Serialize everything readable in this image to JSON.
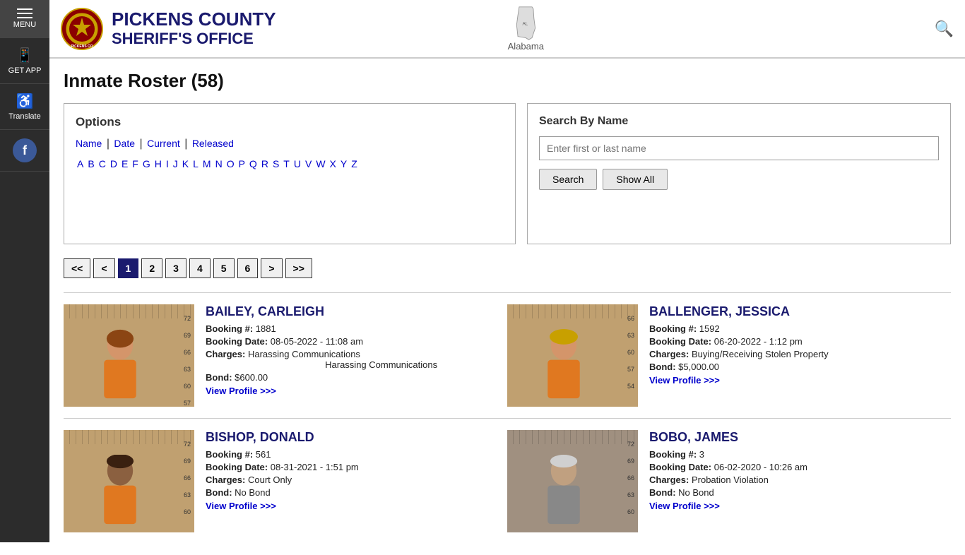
{
  "sidebar": {
    "menu_label": "MENU",
    "getapp_label": "GET APP",
    "translate_label": "Translate",
    "facebook_label": "Facebook"
  },
  "header": {
    "title_line1": "PICKENS COUNTY",
    "title_line2": "SHERIFF'S OFFICE",
    "alabama_label": "Alabama"
  },
  "page": {
    "title": "Inmate Roster (58)"
  },
  "options": {
    "heading": "Options",
    "sort_links": [
      {
        "label": "Name",
        "href": "#"
      },
      {
        "label": "Date",
        "href": "#"
      },
      {
        "label": "Current",
        "href": "#"
      },
      {
        "label": "Released",
        "href": "#"
      }
    ],
    "alpha_links": [
      "A",
      "B",
      "C",
      "D",
      "E",
      "F",
      "G",
      "H",
      "I",
      "J",
      "K",
      "L",
      "M",
      "N",
      "O",
      "P",
      "Q",
      "R",
      "S",
      "T",
      "U",
      "V",
      "W",
      "X",
      "Y",
      "Z"
    ]
  },
  "search": {
    "heading": "Search By Name",
    "placeholder": "Enter first or last name",
    "search_label": "Search",
    "show_all_label": "Show All"
  },
  "pagination": {
    "buttons": [
      "<<",
      "<",
      "1",
      "2",
      "3",
      "4",
      "5",
      "6",
      ">",
      ">>"
    ],
    "active": "1"
  },
  "inmates": [
    {
      "id": "bailey-carleigh",
      "name": "BAILEY, CARLEIGH",
      "booking_num": "1881",
      "booking_date": "08-05-2022 - 11:08 am",
      "charges": "Harassing Communications",
      "charges2": "Harassing Communications",
      "bond": "$600.00",
      "view_profile": "View Profile >>>"
    },
    {
      "id": "ballenger-jessica",
      "name": "BALLENGER, JESSICA",
      "booking_num": "1592",
      "booking_date": "06-20-2022 - 1:12 pm",
      "charges": "Buying/Receiving Stolen Property",
      "charges2": "",
      "bond": "$5,000.00",
      "view_profile": "View Profile >>>"
    },
    {
      "id": "bishop-donald",
      "name": "BISHOP, DONALD",
      "booking_num": "561",
      "booking_date": "08-31-2021 - 1:51 pm",
      "charges": "Court Only",
      "charges2": "",
      "bond": "No Bond",
      "view_profile": "View Profile >>>"
    },
    {
      "id": "bobo-james",
      "name": "BOBO, JAMES",
      "booking_num": "3",
      "booking_date": "06-02-2020 - 10:26 am",
      "charges": "Probation Violation",
      "charges2": "",
      "bond": "No Bond",
      "view_profile": "View Profile >>>"
    }
  ],
  "labels": {
    "booking_num": "Booking #:",
    "booking_date": "Booking Date:",
    "charges": "Charges:",
    "bond": "Bond:"
  }
}
